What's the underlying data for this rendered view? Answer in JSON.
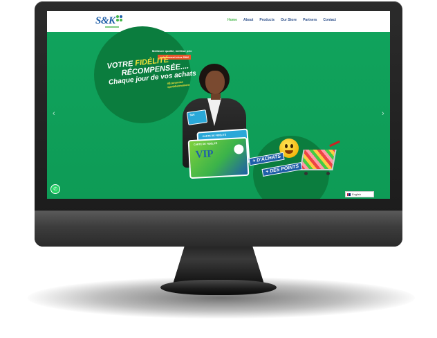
{
  "nav": {
    "items": [
      {
        "label": "Home",
        "active": true
      },
      {
        "label": "About"
      },
      {
        "label": "Products"
      },
      {
        "label": "Our Store"
      },
      {
        "label": "Partners"
      },
      {
        "label": "Contact"
      }
    ]
  },
  "logo": {
    "text": "S&K"
  },
  "hero": {
    "promo_top": "Meilleure qualité, meilleur prix",
    "promo_badge": "uniquement chez S&K",
    "headline_line1_a": "VOTRE ",
    "headline_line1_b": "FIDÉLITÉ",
    "headline_line2": "RÉCOMPENSÉE....",
    "headline_line3": "Chaque jour de vos achats",
    "hashtag": "#Économiez quotidiennement",
    "card_small_label": "S&K",
    "card_back_label": "CARTE DE FIDÉLITÉ",
    "card_vip_label": "CARTE DE FIDÉLITÉ",
    "card_vip_text": "VIP",
    "badge_achats": "+ D'ACHATS",
    "badge_points": "+ DES POINTS"
  },
  "carousel": {
    "prev": "‹",
    "next": "›",
    "slides": 5,
    "active": 0
  },
  "language": {
    "label": "English"
  },
  "colors": {
    "brand_green": "#11a05a",
    "brand_blue": "#1f5fa8",
    "accent_yellow": "#f3e23a"
  }
}
